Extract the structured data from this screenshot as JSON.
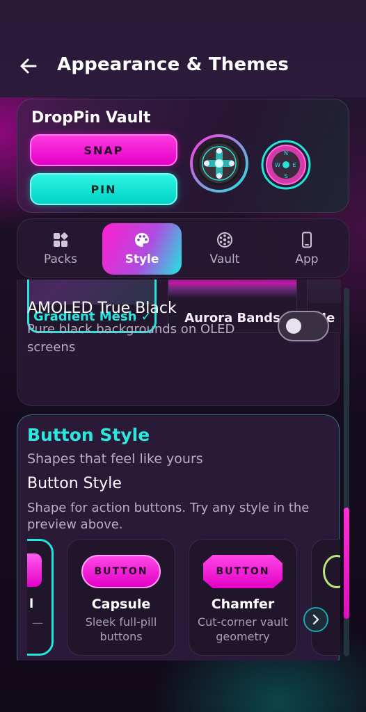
{
  "header": {
    "title": "Appearance & Themes"
  },
  "preview": {
    "title": "DropPin Vault",
    "snap_label": "SNAP",
    "pin_label": "PIN",
    "compass": [
      "N",
      "W",
      "E",
      "S"
    ]
  },
  "tabs": [
    {
      "label": "Packs",
      "icon": "packs-icon"
    },
    {
      "label": "Style",
      "icon": "palette-icon",
      "active": true
    },
    {
      "label": "Vault",
      "icon": "vault-icon"
    },
    {
      "label": "App",
      "icon": "phone-icon"
    }
  ],
  "themes": {
    "tiles": [
      {
        "label": "Gradient Mesh ✓",
        "selected": true
      },
      {
        "label": "Aurora Bands"
      },
      {
        "label": "He"
      }
    ],
    "amoled": {
      "title": "AMOLED True Black",
      "description": "Pure black backgrounds on OLED screens",
      "enabled": false
    }
  },
  "button_style": {
    "heading": "Button Style",
    "subheading": "Shapes that feel like yours",
    "setting_title": "Button Style",
    "setting_description": "Shape for action buttons. Try any style in the preview above.",
    "options": [
      {
        "name": "l",
        "description": "—"
      },
      {
        "name": "Capsule",
        "preview": "BUTTON",
        "description": "Sleek full-pill buttons"
      },
      {
        "name": "Chamfer",
        "preview": "BUTTON",
        "description": "Cut-corner vault geometry"
      }
    ]
  },
  "colors": {
    "accent_magenta": "#ff1fd0",
    "accent_cyan": "#22e6dc"
  }
}
